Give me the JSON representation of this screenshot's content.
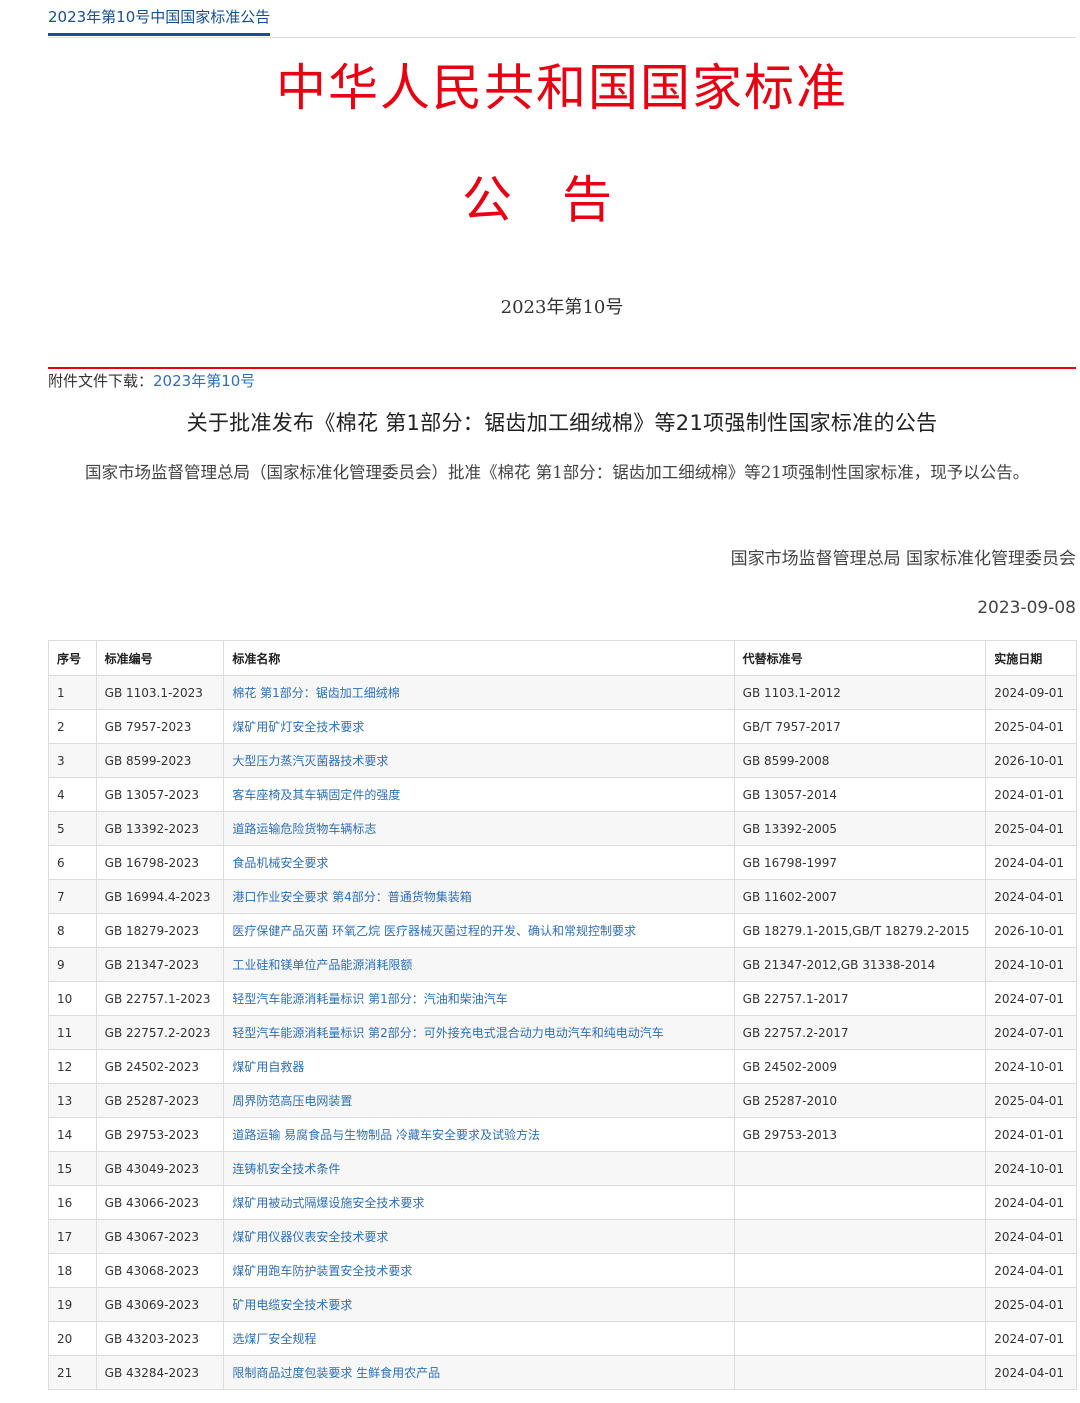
{
  "breadcrumb": "2023年第10号中国国家标准公告",
  "header": {
    "title": "中华人民共和国国家标准",
    "subtitle": "公告",
    "issue": "2023年第10号"
  },
  "attachment": {
    "label": "附件文件下载：",
    "link_text": "2023年第10号"
  },
  "notice": {
    "title": "关于批准发布《棉花 第1部分：锯齿加工细绒棉》等21项强制性国家标准的公告",
    "body": "国家市场监督管理总局（国家标准化管理委员会）批准《棉花 第1部分：锯齿加工细绒棉》等21项强制性国家标准，现予以公告。",
    "signature": "国家市场监督管理总局 国家标准化管理委员会",
    "date": "2023-09-08"
  },
  "table": {
    "headers": [
      "序号",
      "标准编号",
      "标准名称",
      "代替标准号",
      "实施日期"
    ],
    "rows": [
      [
        "1",
        "GB 1103.1-2023",
        "棉花 第1部分：锯齿加工细绒棉",
        "GB 1103.1-2012",
        "2024-09-01"
      ],
      [
        "2",
        "GB 7957-2023",
        "煤矿用矿灯安全技术要求",
        "GB/T 7957-2017",
        "2025-04-01"
      ],
      [
        "3",
        "GB 8599-2023",
        "大型压力蒸汽灭菌器技术要求",
        "GB 8599-2008",
        "2026-10-01"
      ],
      [
        "4",
        "GB 13057-2023",
        "客车座椅及其车辆固定件的强度",
        "GB 13057-2014",
        "2024-01-01"
      ],
      [
        "5",
        "GB 13392-2023",
        "道路运输危险货物车辆标志",
        "GB 13392-2005",
        "2025-04-01"
      ],
      [
        "6",
        "GB 16798-2023",
        "食品机械安全要求",
        "GB 16798-1997",
        "2024-04-01"
      ],
      [
        "7",
        "GB 16994.4-2023",
        "港口作业安全要求 第4部分：普通货物集装箱",
        "GB 11602-2007",
        "2024-04-01"
      ],
      [
        "8",
        "GB 18279-2023",
        "医疗保健产品灭菌 环氧乙烷 医疗器械灭菌过程的开发、确认和常规控制要求",
        "GB 18279.1-2015,GB/T 18279.2-2015",
        "2026-10-01"
      ],
      [
        "9",
        "GB 21347-2023",
        "工业硅和镁单位产品能源消耗限额",
        "GB 21347-2012,GB 31338-2014",
        "2024-10-01"
      ],
      [
        "10",
        "GB 22757.1-2023",
        "轻型汽车能源消耗量标识 第1部分：汽油和柴油汽车",
        "GB 22757.1-2017",
        "2024-07-01"
      ],
      [
        "11",
        "GB 22757.2-2023",
        "轻型汽车能源消耗量标识 第2部分：可外接充电式混合动力电动汽车和纯电动汽车",
        "GB 22757.2-2017",
        "2024-07-01"
      ],
      [
        "12",
        "GB 24502-2023",
        "煤矿用自救器",
        "GB 24502-2009",
        "2024-10-01"
      ],
      [
        "13",
        "GB 25287-2023",
        "周界防范高压电网装置",
        "GB 25287-2010",
        "2025-04-01"
      ],
      [
        "14",
        "GB 29753-2023",
        "道路运输 易腐食品与生物制品 冷藏车安全要求及试验方法",
        "GB 29753-2013",
        "2024-01-01"
      ],
      [
        "15",
        "GB 43049-2023",
        "连铸机安全技术条件",
        "",
        "2024-10-01"
      ],
      [
        "16",
        "GB 43066-2023",
        "煤矿用被动式隔爆设施安全技术要求",
        "",
        "2024-04-01"
      ],
      [
        "17",
        "GB 43067-2023",
        "煤矿用仪器仪表安全技术要求",
        "",
        "2024-04-01"
      ],
      [
        "18",
        "GB 43068-2023",
        "煤矿用跑车防护装置安全技术要求",
        "",
        "2024-04-01"
      ],
      [
        "19",
        "GB 43069-2023",
        "矿用电缆安全技术要求",
        "",
        "2025-04-01"
      ],
      [
        "20",
        "GB 43203-2023",
        "选煤厂安全规程",
        "",
        "2024-07-01"
      ],
      [
        "21",
        "GB 43284-2023",
        "限制商品过度包装要求 生鲜食用农产品",
        "",
        "2024-04-01"
      ]
    ]
  },
  "colors": {
    "header_red": "#e60012",
    "link_blue": "#2f6fb5",
    "breadcrumb_blue": "#1a4e8c"
  }
}
